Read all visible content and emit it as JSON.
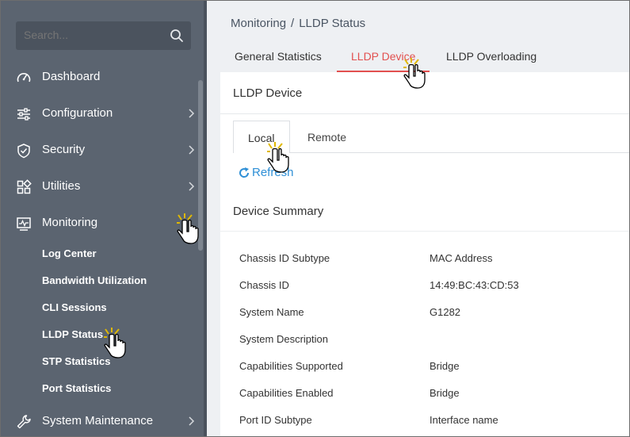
{
  "search": {
    "placeholder": "Search..."
  },
  "sidebar": {
    "items": [
      {
        "label": "Dashboard",
        "icon": "gauge-icon",
        "has_chevron": false
      },
      {
        "label": "Configuration",
        "icon": "sliders-icon",
        "has_chevron": true
      },
      {
        "label": "Security",
        "icon": "shield-icon",
        "has_chevron": true
      },
      {
        "label": "Utilities",
        "icon": "grid-icon",
        "has_chevron": true
      },
      {
        "label": "Monitoring",
        "icon": "monitor-icon",
        "has_chevron": false
      },
      {
        "label": "System Maintenance",
        "icon": "wrench-icon",
        "has_chevron": true
      }
    ],
    "sub_items": [
      "Log Center",
      "Bandwidth Utilization",
      "CLI Sessions",
      "LLDP Status",
      "STP Statistics",
      "Port Statistics"
    ]
  },
  "breadcrumb": {
    "parent": "Monitoring",
    "separator": "/",
    "current": "LLDP Status"
  },
  "tabs": [
    "General Statistics",
    "LLDP Device",
    "LLDP Overloading"
  ],
  "card": {
    "title": "LLDP Device",
    "subtabs": [
      "Local",
      "Remote"
    ],
    "refresh_label": "Refresh",
    "section_title": "Device Summary",
    "rows": [
      {
        "key": "Chassis ID Subtype",
        "value": "MAC Address"
      },
      {
        "key": "Chassis ID",
        "value": "14:49:BC:43:CD:53"
      },
      {
        "key": "System Name",
        "value": "G1282"
      },
      {
        "key": "System Description",
        "value": ""
      },
      {
        "key": "Capabilities Supported",
        "value": "Bridge"
      },
      {
        "key": "Capabilities Enabled",
        "value": "Bridge"
      },
      {
        "key": "Port ID Subtype",
        "value": "Interface name"
      }
    ]
  },
  "colors": {
    "sidebar": "#5b6470",
    "accent": "#e2504f",
    "link": "#2e8fd6",
    "main_bg": "#eef0f3"
  }
}
